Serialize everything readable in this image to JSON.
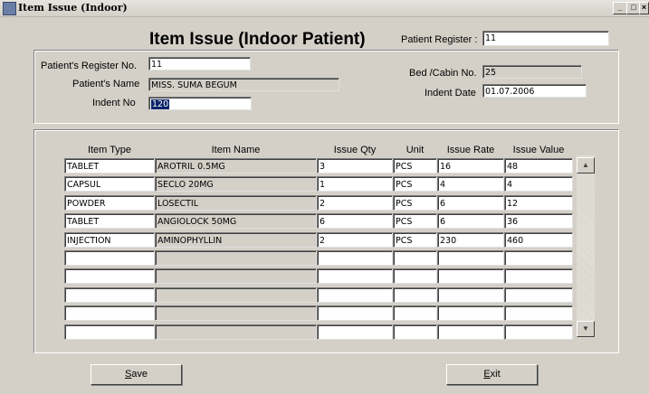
{
  "window": {
    "title": "Item Issue (Indoor)"
  },
  "heading": "Item Issue (Indoor Patient)",
  "header": {
    "register_label": "Patient Register :",
    "register_value": "11"
  },
  "patient": {
    "reg_label": "Patient's Register No.",
    "reg_value": "11",
    "name_label": "Patient's Name",
    "name_value": "MISS. SUMA BEGUM",
    "indent_no_label": "Indent No",
    "indent_no_value": "120",
    "bed_label": "Bed /Cabin No.",
    "bed_value": "25",
    "indent_date_label": "Indent Date",
    "indent_date_value": "01.07.2006"
  },
  "grid": {
    "columns": [
      "Item Type",
      "Item Name",
      "Issue Qty",
      "Unit",
      "Issue Rate",
      "Issue Value"
    ],
    "rows": [
      [
        "TABLET",
        "AROTRIL 0.5MG",
        "3",
        "PCS",
        "16",
        "48"
      ],
      [
        "CAPSUL",
        "SECLO 20MG",
        "1",
        "PCS",
        "4",
        "4"
      ],
      [
        "POWDER",
        "LOSECTIL",
        "2",
        "PCS",
        "6",
        "12"
      ],
      [
        "TABLET",
        "ANGIOLOCK 50MG",
        "6",
        "PCS",
        "6",
        "36"
      ],
      [
        "INJECTION",
        "AMINOPHYLLIN",
        "2",
        "PCS",
        "230",
        "460"
      ],
      [
        "",
        "",
        "",
        "",
        "",
        ""
      ],
      [
        "",
        "",
        "",
        "",
        "",
        ""
      ],
      [
        "",
        "",
        "",
        "",
        "",
        ""
      ],
      [
        "",
        "",
        "",
        "",
        "",
        ""
      ],
      [
        "",
        "",
        "",
        "",
        "",
        ""
      ]
    ]
  },
  "buttons": {
    "save": "Save",
    "exit": "Exit"
  },
  "controls": {
    "minimize": "_",
    "maximize": "□",
    "close": "×"
  }
}
